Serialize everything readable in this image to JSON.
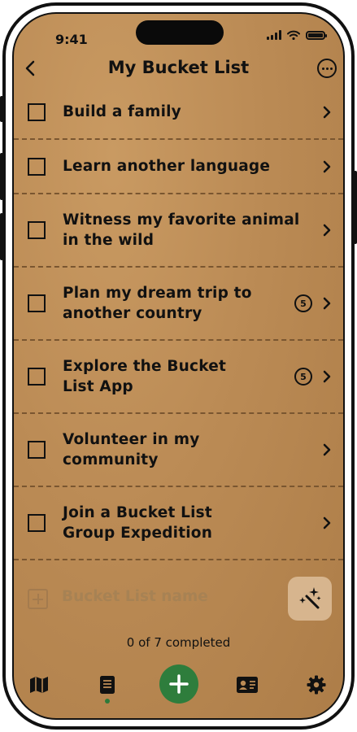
{
  "status_bar": {
    "time": "9:41"
  },
  "header": {
    "title": "My Bucket List"
  },
  "items": [
    {
      "label": "Build a family",
      "count": ""
    },
    {
      "label": "Learn another language",
      "count": ""
    },
    {
      "label": "Witness my favorite animal in the wild",
      "count": ""
    },
    {
      "label": "Plan my dream trip to another country",
      "count": "5"
    },
    {
      "label": "Explore the Bucket List App",
      "count": "5"
    },
    {
      "label": "Volunteer in my community",
      "count": ""
    },
    {
      "label": "Join a Bucket List Group Expedition",
      "count": ""
    }
  ],
  "add_row": {
    "placeholder": "Bucket List name"
  },
  "progress": {
    "text": "0 of 7 completed"
  },
  "tabbar": {
    "tabs": [
      "map-icon",
      "list-icon",
      "add-icon",
      "profile-card-icon",
      "gear-icon"
    ],
    "active_index": 1,
    "accent_color": "#2e7d3c"
  },
  "colors": {
    "background": "#bb8b55",
    "divider": "#7a5630"
  }
}
